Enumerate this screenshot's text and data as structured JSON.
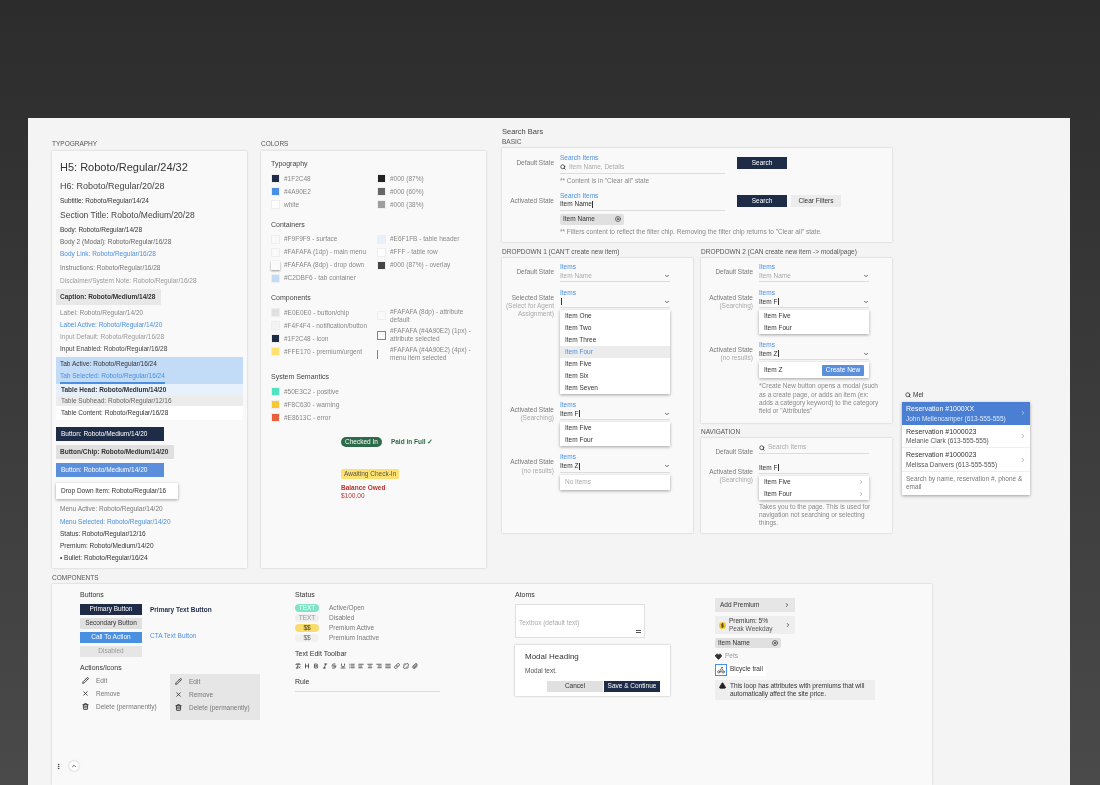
{
  "typography": {
    "heading": "TYPOGRAPHY",
    "items": [
      {
        "kind": "h5",
        "text": "H5: Roboto/Regular/24/32"
      },
      {
        "kind": "h6",
        "text": "H6: Roboto/Regular/20/28"
      },
      {
        "kind": "subtitle",
        "text": "Subtitle: Roboto/Regular/14/24"
      },
      {
        "kind": "section",
        "text": "Section Title: Roboto/Medium/20/28"
      },
      {
        "kind": "body",
        "text": "Body: Roboto/Regular/14/28"
      },
      {
        "kind": "body2",
        "text": "Body 2 (Modal): Roboto/Regular/16/28"
      },
      {
        "kind": "link",
        "text": "Body Link: Roboto/Regular/16/28"
      },
      {
        "kind": "instructions",
        "text": "Instructions: Roboto/Regular/16/28"
      },
      {
        "kind": "disclaimer",
        "text": "Disclaimer/System Note: Roboto/Regular/16/28"
      },
      {
        "kind": "caption",
        "text": "Caption: Roboto/Medium/14/28"
      },
      {
        "kind": "label",
        "text": "Label: Roboto/Regular/14/20"
      },
      {
        "kind": "label_active",
        "text": "Label Active: Roboto/Regular/14/20"
      },
      {
        "kind": "input_default",
        "text": "Input Default: Roboto/Regular/16/28"
      },
      {
        "kind": "input_enabled",
        "text": "Input Enabled: Roboto/Regular/16/28"
      },
      {
        "kind": "table",
        "tabs": [
          {
            "label": "Tab Active: Roboto/Regular/16/24",
            "selected": false
          },
          {
            "label": "Tab Selected: Roboto/Regular/16/24",
            "selected": true
          }
        ],
        "head": "Table Head: Roboto/Medium/14/20",
        "subhead": "Table Subhead: Roboto/Regular/12/16",
        "content": "Table Content: Roboto/Regular/16/28"
      },
      {
        "kind": "button_dark",
        "text": "Button: Roboto/Medium/14/20"
      },
      {
        "kind": "button_chip",
        "text": "Button/Chip: Roboto/Medium/14/20"
      },
      {
        "kind": "button_blue",
        "text": "Button: Roboto/Medium/14/20"
      },
      {
        "kind": "dropdown_item",
        "text": "Drop Down Item: Roboto/Regular/16"
      },
      {
        "kind": "menu_active",
        "text": "Menu Active: Roboto/Regular/14/20"
      },
      {
        "kind": "menu_selected",
        "text": "Menu Selected: Roboto/Regular/14/20"
      },
      {
        "kind": "status",
        "text": "Status: Roboto/Regular/12/16"
      },
      {
        "kind": "premium",
        "text": "Premium: Roboto/Medium/14/20"
      },
      {
        "kind": "bullet",
        "text": "• Bullet: Roboto/Regular/16/24"
      }
    ]
  },
  "colors": {
    "heading": "COLORS",
    "groups": [
      {
        "title": "Typography",
        "columns": [
          [
            {
              "kind": "fill",
              "color": "#1f2c48",
              "label": "#1F2C48"
            },
            {
              "kind": "fill",
              "color": "#4a90e2",
              "label": "#4A90E2"
            },
            {
              "kind": "fill",
              "color": "#ffffff",
              "label": "white"
            }
          ],
          [
            {
              "kind": "fill",
              "color": "#222222",
              "label": "#000 (87%)"
            },
            {
              "kind": "fill",
              "color": "#666666",
              "label": "#000 (60%)"
            },
            {
              "kind": "fill",
              "color": "#9e9e9e",
              "label": "#000 (38%)"
            }
          ]
        ]
      },
      {
        "title": "Containers",
        "columns": [
          [
            {
              "kind": "fill",
              "color": "#f9f9f9",
              "label": "#F9F9F9 - surface"
            },
            {
              "kind": "fill",
              "color": "#fafafa",
              "label": "#FAFAFA (1dp) - main menu"
            },
            {
              "kind": "raised",
              "color": "#fafafa",
              "label": "#FAFAFA (8dp) - drop down"
            },
            {
              "kind": "fill",
              "color": "#c2dbf6",
              "label": "#C2DBF6 - tab container"
            }
          ],
          [
            {
              "kind": "fill",
              "color": "#e6f1fb",
              "label": "#E6F1FB - table header"
            },
            {
              "kind": "fill",
              "color": "#ffffff",
              "label": "#FFF - table row"
            },
            {
              "kind": "fill",
              "color": "#444444",
              "label": "#000 (87%) - overlay"
            }
          ]
        ]
      },
      {
        "title": "Components",
        "columns": [
          [
            {
              "kind": "fill",
              "color": "#e0e0e0",
              "label": "#E0E0E0 - button/chip"
            },
            {
              "kind": "fill",
              "color": "#f4f4f4",
              "label": "#F4F4F4 - notification/button"
            },
            {
              "kind": "fill",
              "color": "#1f2c48",
              "label": "#1F2C48 - icon"
            },
            {
              "kind": "fill",
              "color": "#ffe170",
              "label": "#FFE170 - premium/urgent"
            }
          ],
          [
            {
              "kind": "fill",
              "color": "#fafafa",
              "label": "#FAFAFA (8dp) - attribute default"
            },
            {
              "kind": "outline",
              "color": "#4a90e2",
              "label": "#FAFAFA (#4A90E2) (1px) - attribute selected"
            },
            {
              "kind": "bar",
              "color": "#4a90e2",
              "label": "#FAFAFA (#4A90E2) (4px) - menu item selected"
            }
          ]
        ]
      },
      {
        "title": "System Semantics",
        "columns": [
          [
            {
              "kind": "fill",
              "color": "#50e3c2",
              "label": "#50E3C2 - positive"
            },
            {
              "kind": "fill",
              "color": "#f8c630",
              "label": "#F8C630 - warning"
            },
            {
              "kind": "fill",
              "color": "#e8613c",
              "label": "#E8613C - error"
            }
          ]
        ]
      }
    ],
    "checked_in": "Checked In",
    "paid": "Paid in Full ✓",
    "awaiting": "Awaiting Check-In",
    "balance_label": "Balance Owed",
    "balance_value": "$100.00"
  },
  "search_bars": {
    "title": "Search Bars",
    "heading": "BASIC",
    "rows": [
      {
        "state": "Default State",
        "label": "Search Items",
        "placeholder": "Item Name, Details",
        "buttons": [
          "Search"
        ],
        "note": "** Content is in \"Clear all\" state"
      },
      {
        "state": "Activated State",
        "label": "Search Items",
        "value": "Item Name",
        "buttons": [
          "Search",
          "Clear Filters"
        ],
        "chip": "Item Name",
        "note": "** Filters content to reflect the filter chip. Removing the filter chip returns to \"Clear all\" state."
      }
    ]
  },
  "dropdowns": [
    {
      "title": "DROPDOWN 1 (CAN'T create new item)",
      "rows": [
        {
          "state": "Default State",
          "label": "Items",
          "placeholder": "Item Name",
          "kind": "none"
        },
        {
          "state": "Selected State",
          "sub": "(Select for Agent Assignment)",
          "label": "Items",
          "value": "",
          "kind": "list",
          "items": [
            {
              "text": "Item One",
              "selected": false
            },
            {
              "text": "Item Two",
              "selected": false
            },
            {
              "text": "Item Three",
              "selected": false
            },
            {
              "text": "Item Four",
              "selected": true
            },
            {
              "text": "Item Five",
              "selected": false
            },
            {
              "text": "Item Six",
              "selected": false
            },
            {
              "text": "Item Seven",
              "selected": false
            }
          ]
        },
        {
          "state": "Activated State",
          "sub": "(Searching)",
          "label": "Items",
          "value": "Item F",
          "kind": "list",
          "items": [
            {
              "text": "Item Five",
              "selected": false
            },
            {
              "text": "Item Four",
              "selected": false
            }
          ]
        },
        {
          "state": "Activated State",
          "sub": "(no results)",
          "label": "Items",
          "value": "Item Z",
          "kind": "empty",
          "empty": "No Items"
        }
      ]
    },
    {
      "title": "DROPDOWN 2 (CAN create new item -> modal/page)",
      "rows": [
        {
          "state": "Default State",
          "label": "Items",
          "placeholder": "Item Name",
          "kind": "none"
        },
        {
          "state": "Activated State",
          "sub": "(Searching)",
          "label": "Items",
          "value": "Item F",
          "kind": "list",
          "items": [
            {
              "text": "Item Five",
              "selected": false
            },
            {
              "text": "Item Four",
              "selected": false
            }
          ]
        },
        {
          "state": "Activated State",
          "sub": "(no results)",
          "label": "Items",
          "value": "Item Z",
          "kind": "create",
          "create_text": "Item Z",
          "create_button": "Create New",
          "note": "*Create New button opens a modal (such as a create page, or adds an item (ex: adds a category keyword) to the category field or \"Attributes\""
        }
      ]
    }
  ],
  "navigation": {
    "heading": "NAVIGATION",
    "rows": [
      {
        "state": "Default State",
        "placeholder": "Search Items"
      },
      {
        "state": "Activated State",
        "sub": "(Searching)",
        "value": "Item F",
        "items": [
          "Item Five",
          "Item Four"
        ],
        "note": "Takes you to the page. This is used for navigation not searching or selecting things."
      }
    ]
  },
  "quick_search": {
    "value": "Mel",
    "results": [
      {
        "title": "Reservation #1000XX",
        "detail": "John Mellencamper (613-555-555)",
        "selected": true
      },
      {
        "title": "Reservation #1000023",
        "detail": "Melanie Clark (613-555-555)",
        "selected": false
      },
      {
        "title": "Reservation #1000023",
        "detail": "Melissa Danvers (613-555-555)",
        "selected": false
      }
    ],
    "hint": "Search by name, reservation #, phone & email"
  },
  "components": {
    "heading": "COMPONENTS",
    "buttons": {
      "title": "Buttons",
      "items": [
        {
          "kind": "primary",
          "label": "Primary Button"
        },
        {
          "kind": "secondary",
          "label": "Secondary Button"
        },
        {
          "kind": "cta",
          "label": "Call To Action"
        },
        {
          "kind": "disabled",
          "label": "Disabled"
        }
      ],
      "text_buttons": [
        {
          "kind": "primary",
          "label": "Primary Text Button"
        },
        {
          "kind": "cta",
          "label": "CTA Text Button"
        }
      ]
    },
    "actions": {
      "title": "Actions/Icons",
      "items": [
        {
          "kind": "edit",
          "label": "Edit"
        },
        {
          "kind": "remove",
          "label": "Remove"
        },
        {
          "kind": "delete",
          "label": "Delete (permanently)"
        }
      ],
      "panel_items": [
        {
          "kind": "edit",
          "label": "Edit"
        },
        {
          "kind": "remove",
          "label": "Remove"
        },
        {
          "kind": "delete",
          "label": "Delete (permanently)"
        }
      ]
    },
    "status": {
      "title": "Status",
      "items": [
        {
          "kind": "active",
          "chip": "TEXT",
          "label": "Active/Open"
        },
        {
          "kind": "disabled",
          "chip": "TEXT",
          "label": "Disabled"
        },
        {
          "kind": "premium_active",
          "chip": "$$",
          "label": "Premium Active"
        },
        {
          "kind": "premium_inactive",
          "chip": "$$",
          "label": "Premium Inactive"
        }
      ]
    },
    "toolbar_title": "Text Edit Toolbar",
    "rule_title": "Rule",
    "atoms": {
      "title": "Atoms",
      "textbox": "Textbox (default text)",
      "modal": {
        "heading": "Modal Heading",
        "text": "Modal text.",
        "cancel": "Cancel",
        "save": "Save & Continue"
      },
      "add_premium": "Add Premium",
      "premium_title": "Premium: 5%",
      "premium_detail": "Peak Weekday",
      "chip": "Item Name",
      "heart_label": "Pets",
      "attribute": "Bicycle trail",
      "warning": "This loop has attributes with premiums that will automatically affect the site price."
    }
  }
}
